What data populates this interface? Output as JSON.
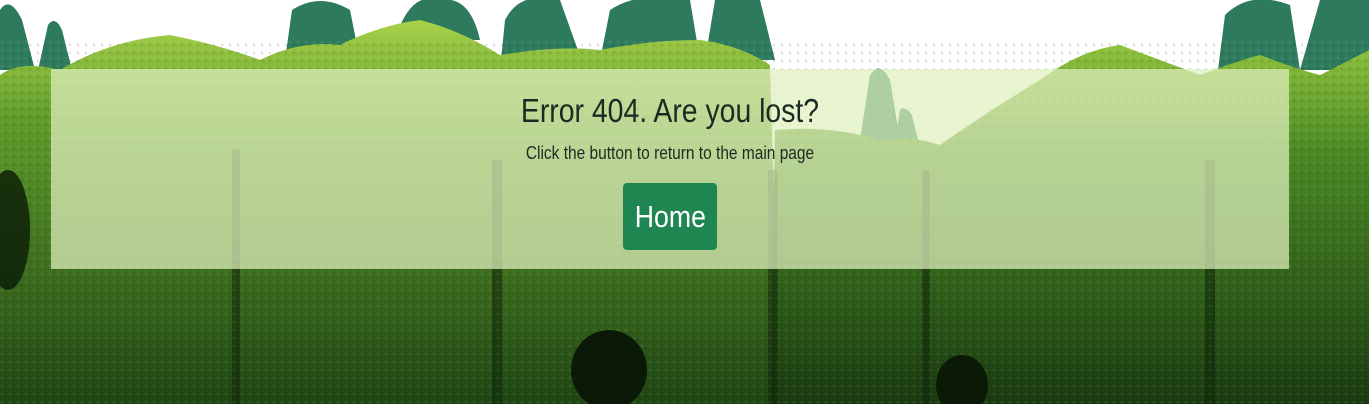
{
  "error": {
    "title": "Error 404. Are you lost?",
    "message": "Click the button to return to the main page",
    "home_button_label": "Home"
  },
  "colors": {
    "button_background": "#1e8650",
    "button_text": "#ffffff",
    "panel_overlay": "rgba(225,240,190,0.72)",
    "title_text": "#1d2a22",
    "hedge_dark": "#244d15",
    "hedge_light": "#9acb3c"
  },
  "background": {
    "description_icon": "hedge-maze-image"
  }
}
